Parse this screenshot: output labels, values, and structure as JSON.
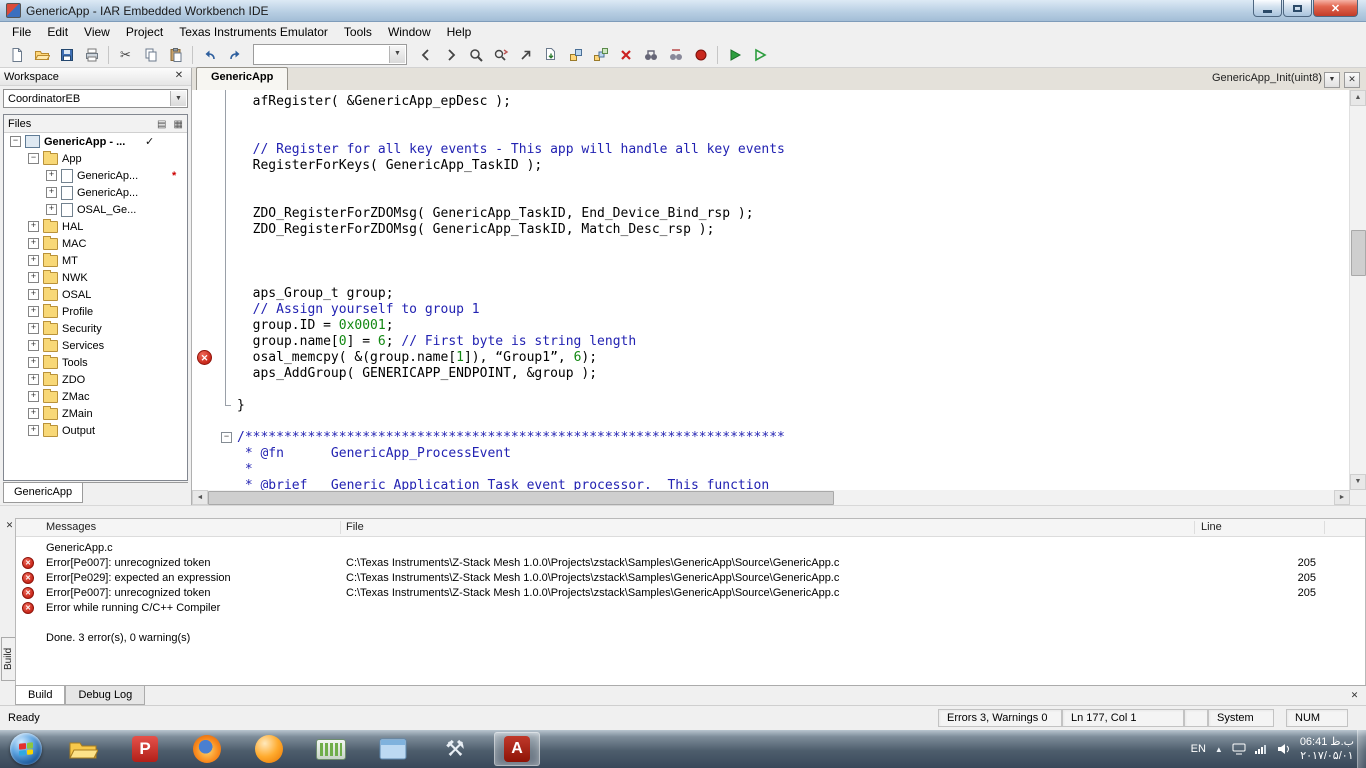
{
  "window": {
    "title": "GenericApp - IAR Embedded Workbench IDE"
  },
  "menu": {
    "items": [
      "File",
      "Edit",
      "View",
      "Project",
      "Texas Instruments Emulator",
      "Tools",
      "Window",
      "Help"
    ]
  },
  "toolbar": {
    "find_value": "",
    "buttons": [
      {
        "name": "new-document"
      },
      {
        "name": "open"
      },
      {
        "name": "save"
      },
      {
        "name": "print"
      },
      {
        "sep": true
      },
      {
        "name": "cut"
      },
      {
        "name": "copy"
      },
      {
        "name": "paste"
      },
      {
        "sep": true
      },
      {
        "name": "undo"
      },
      {
        "name": "redo"
      },
      {
        "combo": true
      },
      {
        "name": "nav-back"
      },
      {
        "name": "nav-forward"
      },
      {
        "name": "find"
      },
      {
        "name": "replace"
      },
      {
        "name": "goto"
      },
      {
        "name": "compile"
      },
      {
        "name": "make"
      },
      {
        "name": "build-all"
      },
      {
        "name": "stop-build"
      },
      {
        "name": "find-in-files"
      },
      {
        "name": "replace-in-files"
      },
      {
        "name": "toggle-breakpoint"
      },
      {
        "sep": true
      },
      {
        "name": "download-debug"
      },
      {
        "name": "debug-without-download"
      }
    ]
  },
  "workspace": {
    "title": "Workspace",
    "config": "CoordinatorEB",
    "files_header": "Files",
    "bottom_tab": "GenericApp",
    "tree": [
      {
        "label": "GenericApp - ...",
        "level": 0,
        "icon": "project",
        "expand": "minus",
        "bold": true,
        "mark": "check"
      },
      {
        "label": "App",
        "level": 1,
        "icon": "folder",
        "expand": "minus"
      },
      {
        "label": "GenericAp...",
        "level": 2,
        "icon": "file",
        "expand": "plus",
        "mark": "star"
      },
      {
        "label": "GenericAp...",
        "level": 2,
        "icon": "file",
        "expand": "plus"
      },
      {
        "label": "OSAL_Ge...",
        "level": 2,
        "icon": "file",
        "expand": "plus"
      },
      {
        "label": "HAL",
        "level": 1,
        "icon": "folder",
        "expand": "plus"
      },
      {
        "label": "MAC",
        "level": 1,
        "icon": "folder",
        "expand": "plus"
      },
      {
        "label": "MT",
        "level": 1,
        "icon": "folder",
        "expand": "plus"
      },
      {
        "label": "NWK",
        "level": 1,
        "icon": "folder",
        "expand": "plus"
      },
      {
        "label": "OSAL",
        "level": 1,
        "icon": "folder",
        "expand": "plus"
      },
      {
        "label": "Profile",
        "level": 1,
        "icon": "folder",
        "expand": "plus"
      },
      {
        "label": "Security",
        "level": 1,
        "icon": "folder",
        "expand": "plus"
      },
      {
        "label": "Services",
        "level": 1,
        "icon": "folder",
        "expand": "plus"
      },
      {
        "label": "Tools",
        "level": 1,
        "icon": "folder",
        "expand": "plus"
      },
      {
        "label": "ZDO",
        "level": 1,
        "icon": "folder",
        "expand": "plus"
      },
      {
        "label": "ZMac",
        "level": 1,
        "icon": "folder",
        "expand": "plus"
      },
      {
        "label": "ZMain",
        "level": 1,
        "icon": "folder",
        "expand": "plus"
      },
      {
        "label": "Output",
        "level": 1,
        "icon": "folder",
        "expand": "plus"
      }
    ]
  },
  "editor": {
    "tab": "GenericApp",
    "function_selector": "GenericApp_Init(uint8)",
    "code": [
      [
        [
          "  afRegister( &GenericApp_epDesc );",
          "p"
        ]
      ],
      [],
      [],
      [
        [
          "  // Register for all key events - This app will handle all key events",
          "cm"
        ]
      ],
      [
        [
          "  RegisterForKeys( GenericApp_TaskID );",
          "p"
        ]
      ],
      [],
      [],
      [
        [
          "  ZDO_RegisterForZDOMsg( GenericApp_TaskID, End_Device_Bind_rsp );",
          "p"
        ]
      ],
      [
        [
          "  ZDO_RegisterForZDOMsg( GenericApp_TaskID, Match_Desc_rsp );",
          "p"
        ]
      ],
      [],
      [],
      [],
      [
        [
          "  aps_Group_t group;",
          "p"
        ]
      ],
      [
        [
          "  // Assign yourself to group 1",
          "cm"
        ]
      ],
      [
        [
          "  group.ID = ",
          "p"
        ],
        [
          "0x0001",
          "n"
        ],
        [
          ";",
          "p"
        ]
      ],
      [
        [
          "  group.name[",
          "p"
        ],
        [
          "0",
          "n"
        ],
        [
          "] = ",
          "p"
        ],
        [
          "6",
          "n"
        ],
        [
          "; ",
          "p"
        ],
        [
          "// First byte is string length",
          "cm"
        ]
      ],
      [
        [
          "  osal_memcpy( &(group.name[",
          "p"
        ],
        [
          "1",
          "n"
        ],
        [
          "]), “Group1”, ",
          "p"
        ],
        [
          "6",
          "n"
        ],
        [
          ");",
          "p"
        ]
      ],
      [
        [
          "  aps_AddGroup( GENERICAPP_ENDPOINT, &group );",
          "p"
        ]
      ],
      [],
      [
        [
          "}",
          "p"
        ]
      ],
      [],
      [
        [
          "/*********************************************************************",
          "cm"
        ]
      ],
      [
        [
          " * @fn      GenericApp_ProcessEvent",
          "cm"
        ]
      ],
      [
        [
          " *",
          "cm"
        ]
      ],
      [
        [
          " * @brief   Generic Application Task event processor.  This function",
          "cm"
        ]
      ]
    ]
  },
  "build": {
    "columns": {
      "messages": "Messages",
      "file": "File",
      "line": "Line"
    },
    "tabs": [
      "Build",
      "Debug Log"
    ],
    "side_tab": "Build",
    "rows": [
      {
        "error": false,
        "text": "GenericApp.c",
        "file": "",
        "line": ""
      },
      {
        "error": true,
        "text": "Error[Pe007]: unrecognized token",
        "file": "C:\\Texas Instruments\\Z-Stack Mesh 1.0.0\\Projects\\zstack\\Samples\\GenericApp\\Source\\GenericApp.c",
        "line": "205"
      },
      {
        "error": true,
        "text": "Error[Pe029]: expected an expression",
        "file": "C:\\Texas Instruments\\Z-Stack Mesh 1.0.0\\Projects\\zstack\\Samples\\GenericApp\\Source\\GenericApp.c",
        "line": "205"
      },
      {
        "error": true,
        "text": "Error[Pe007]: unrecognized token",
        "file": "C:\\Texas Instruments\\Z-Stack Mesh 1.0.0\\Projects\\zstack\\Samples\\GenericApp\\Source\\GenericApp.c",
        "line": "205"
      },
      {
        "error": true,
        "text": "Error while running C/C++ Compiler",
        "file": "",
        "line": ""
      },
      {
        "error": false,
        "text": "",
        "file": "",
        "line": ""
      },
      {
        "error": false,
        "text": "Done. 3 error(s), 0 warning(s)",
        "file": "",
        "line": ""
      }
    ]
  },
  "statusbar": {
    "ready": "Ready",
    "errors": "Errors 3, Warnings 0",
    "position": "Ln 177, Col 1",
    "system": "System",
    "num": "NUM"
  },
  "taskbar": {
    "apps": [
      {
        "name": "explorer"
      },
      {
        "name": "app-p"
      },
      {
        "name": "firefox"
      },
      {
        "name": "media-orange"
      },
      {
        "name": "green-app"
      },
      {
        "name": "windows-app"
      },
      {
        "name": "tools-app"
      },
      {
        "name": "adobe-reader",
        "active": true
      }
    ],
    "tray": {
      "language": "EN",
      "time": "06:41 ب.ظ",
      "date": "۲۰۱۷/۰۵/۰۱"
    }
  },
  "colors": {
    "comment": "#2222b2",
    "number": "#118811",
    "error": "#c8281b",
    "titlebar": "#b6cde2"
  }
}
